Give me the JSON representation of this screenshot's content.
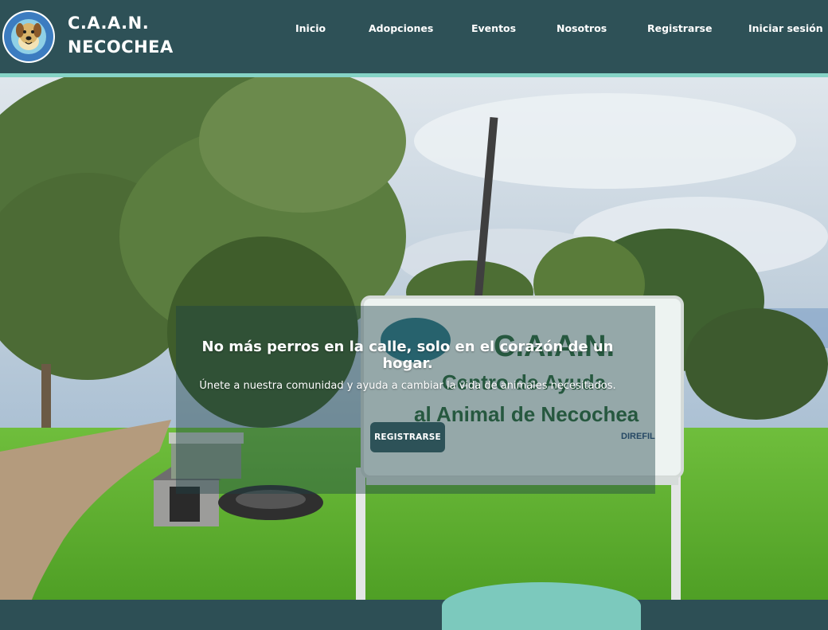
{
  "brand": {
    "line1": "C.A.A.N.",
    "line2": "NECOCHEA"
  },
  "logo": {
    "icon": "dog-logo-icon",
    "ring_text_top": "CENTRO DE AYUDA",
    "ring_text_bottom": "AL ANIMAL DE NECOCHEA"
  },
  "nav": {
    "items": [
      "Inicio",
      "Adopciones",
      "Eventos",
      "Nosotros",
      "Registrarse",
      "Iniciar sesión"
    ]
  },
  "hero": {
    "title": "No más perros en la calle, solo en el corazón de un hogar.",
    "subtitle": "Únete a nuestra comunidad y ayuda a cambiar la vida de animales necesitados.",
    "cta_label": "REGISTRARSE",
    "sign_line1": "C.A.A.N.",
    "sign_line2": "Centro de Ayuda",
    "sign_line3": "al Animal de Necochea",
    "sign_sponsor": "DIREFIL"
  },
  "colors": {
    "header_bg": "#2e5157",
    "accent_stripe": "#86d3c6",
    "button_bg": "#2d5258"
  }
}
